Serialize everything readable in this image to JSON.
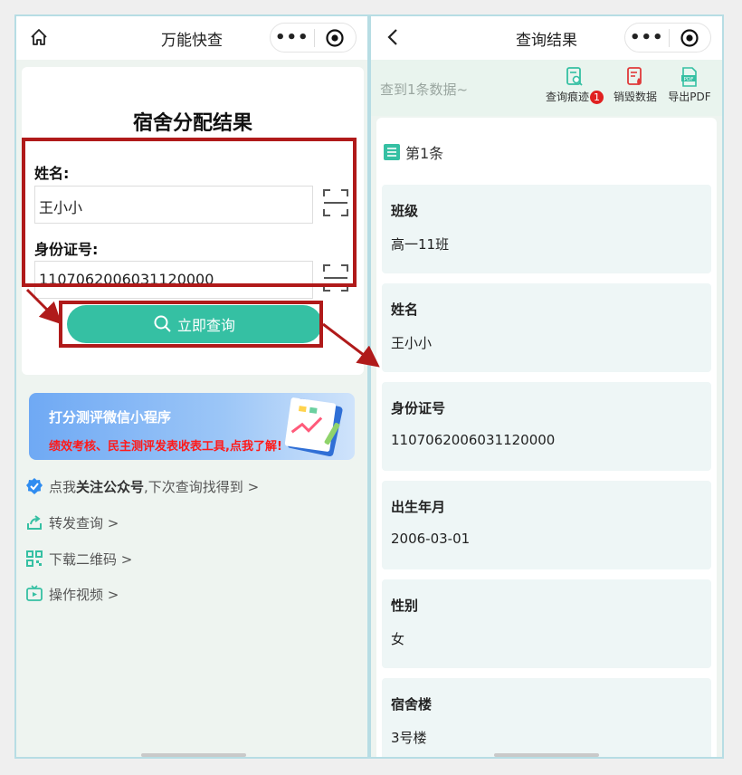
{
  "left": {
    "nav": {
      "title": "万能快查",
      "more": "•••"
    },
    "form": {
      "title": "宿舍分配结果",
      "name_label": "姓名:",
      "name_value": "王小小",
      "id_label": "身份证号:",
      "id_value": "1107062006031120000",
      "query_button": "立即查询"
    },
    "banner": {
      "title": "打分测评微信小程序",
      "subtitle": "绩效考核、民主测评发表收表工具,点我了解!"
    },
    "links": {
      "follow_prefix": "点我",
      "follow_bold": "关注公众号",
      "follow_suffix": ",下次查询找得到 >",
      "forward": "转发查询 >",
      "qrcode": "下载二维码 >",
      "video": "操作视频 >"
    }
  },
  "right": {
    "nav": {
      "title": "查询结果",
      "more": "•••"
    },
    "toolbar": {
      "result_count": "查到1条数据~",
      "trace_label": "查询痕迹",
      "trace_badge": "1",
      "destroy_label": "销毁数据",
      "export_label": "导出PDF"
    },
    "record_title": "第1条",
    "fields": [
      {
        "label": "班级",
        "value": "高一11班"
      },
      {
        "label": "姓名",
        "value": "王小小"
      },
      {
        "label": "身份证号",
        "value": "1107062006031120000"
      },
      {
        "label": "出生年月",
        "value": "2006-03-01"
      },
      {
        "label": "性别",
        "value": "女"
      },
      {
        "label": "宿舍楼",
        "value": "3号楼"
      }
    ]
  },
  "colors": {
    "accent": "#35c0a3",
    "annotation": "#b01a1a",
    "badge": "#e02020",
    "banner_warning": "#ff1a1a"
  }
}
